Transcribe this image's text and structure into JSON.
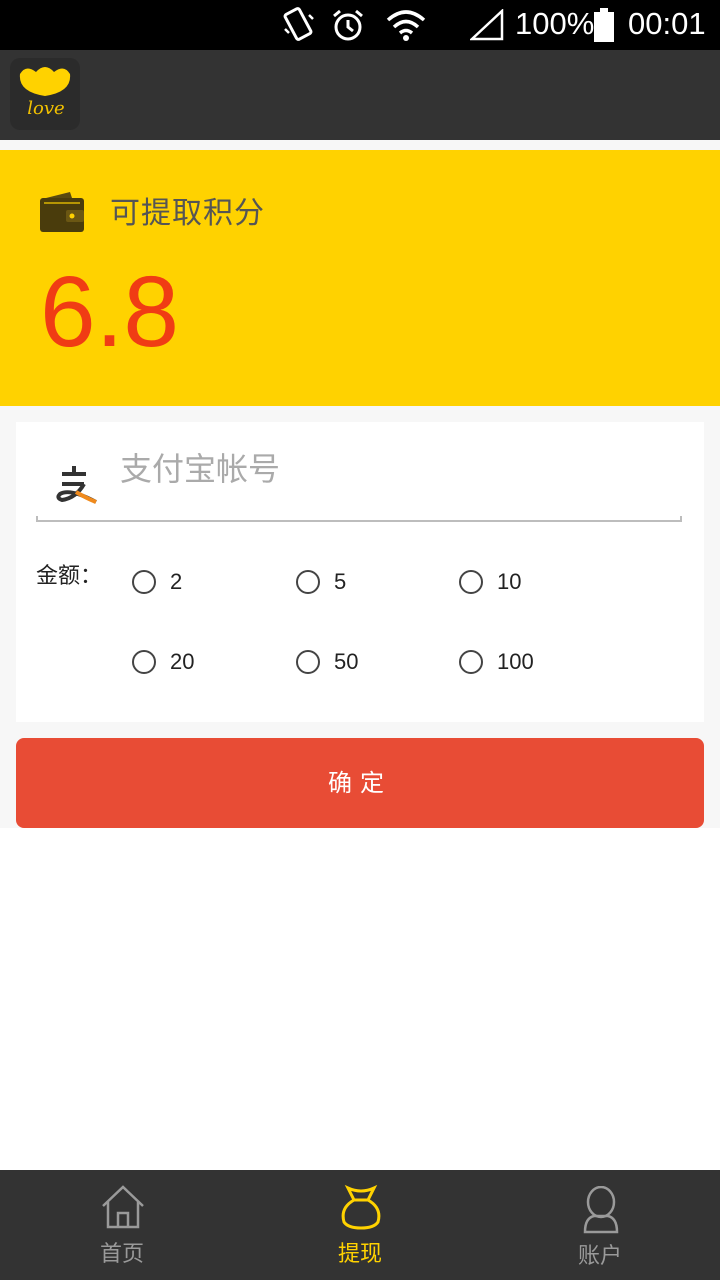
{
  "status_bar": {
    "battery": "100%",
    "time": "00:01"
  },
  "app": {
    "logo_text": "love"
  },
  "points": {
    "label": "可提取积分",
    "value": "6.8"
  },
  "form": {
    "account_placeholder": "支付宝帐号",
    "account_value": "",
    "amount_label": "金额：",
    "options": [
      "2",
      "5",
      "10",
      "20",
      "50",
      "100"
    ],
    "selected": null
  },
  "confirm_label": "确定",
  "nav": {
    "items": [
      {
        "label": "首页",
        "icon": "home-icon",
        "active": false
      },
      {
        "label": "提现",
        "icon": "money-bag-icon",
        "active": true
      },
      {
        "label": "账户",
        "icon": "user-icon",
        "active": false
      }
    ],
    "active_color": "#ffd200",
    "inactive_color": "#9a9a9a"
  },
  "colors": {
    "accent_yellow": "#ffd200",
    "points_value": "#f03c14",
    "confirm_button": "#e84c35"
  }
}
